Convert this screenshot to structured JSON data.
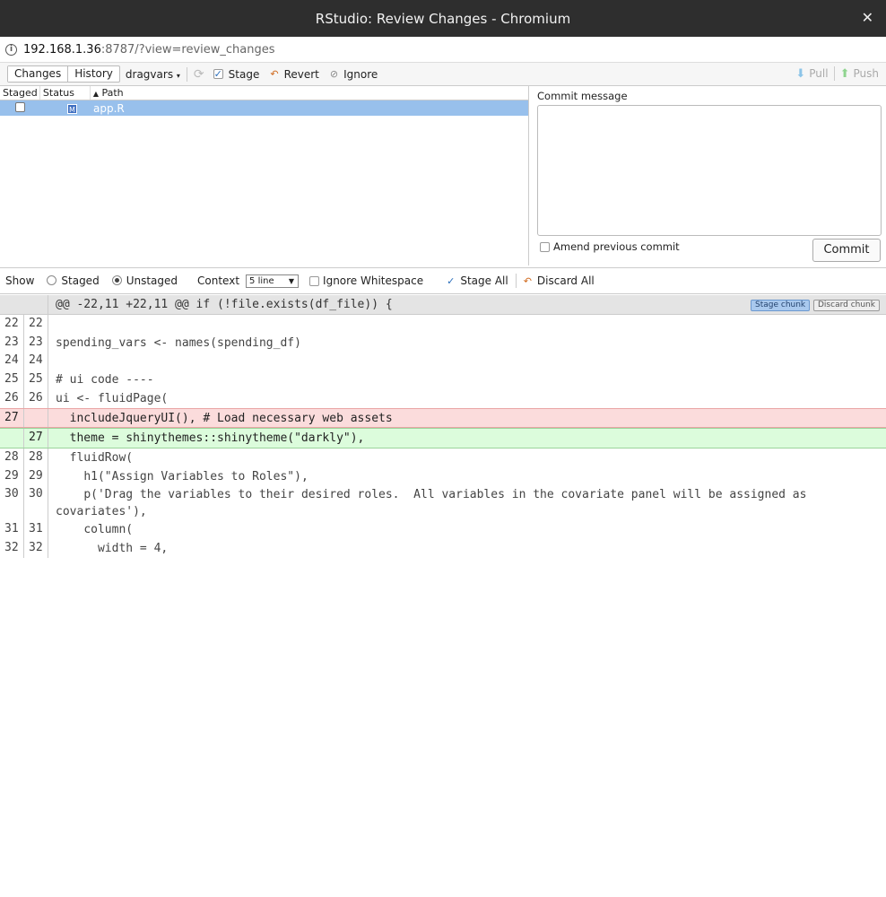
{
  "window": {
    "title": "RStudio: Review Changes - Chromium",
    "close_icon": "close-icon"
  },
  "url": {
    "host": "192.168.1.36",
    "path": ":8787/?view=review_changes"
  },
  "toolbar": {
    "tabs": [
      "Changes",
      "History"
    ],
    "branch": "dragvars",
    "stage_label": "Stage",
    "revert_label": "Revert",
    "ignore_label": "Ignore",
    "pull_label": "Pull",
    "push_label": "Push"
  },
  "files": {
    "columns": [
      "Staged",
      "Status",
      "Path"
    ],
    "rows": [
      {
        "status": "M",
        "path": "app.R",
        "staged": false
      }
    ]
  },
  "commit": {
    "label": "Commit message",
    "message": "",
    "amend_label": "Amend previous commit",
    "button": "Commit"
  },
  "diffbar": {
    "show_label": "Show",
    "staged_label": "Staged",
    "unstaged_label": "Unstaged",
    "context_label": "Context",
    "context_value": "5 line",
    "ignore_ws_label": "Ignore Whitespace",
    "stage_all_label": "Stage All",
    "discard_all_label": "Discard All"
  },
  "diff": {
    "hunk_header": "@@ -22,11 +22,11 @@ if (!file.exists(df_file)) {",
    "stage_chunk": "Stage chunk",
    "discard_chunk": "Discard chunk",
    "lines": [
      {
        "old": "22",
        "new": "22",
        "type": "ctx",
        "code": ""
      },
      {
        "old": "23",
        "new": "23",
        "type": "ctx",
        "code": "spending_vars <- names(spending_df)"
      },
      {
        "old": "24",
        "new": "24",
        "type": "ctx",
        "code": ""
      },
      {
        "old": "25",
        "new": "25",
        "type": "ctx",
        "code": "# ui code ----"
      },
      {
        "old": "26",
        "new": "26",
        "type": "ctx",
        "code": "ui <- fluidPage("
      },
      {
        "old": "27",
        "new": "",
        "type": "del",
        "code": "  includeJqueryUI(), # Load necessary web assets"
      },
      {
        "old": "",
        "new": "27",
        "type": "add",
        "code": "  theme = shinythemes::shinytheme(\"darkly\"),"
      },
      {
        "old": "28",
        "new": "28",
        "type": "ctx",
        "code": "  fluidRow("
      },
      {
        "old": "29",
        "new": "29",
        "type": "ctx",
        "code": "    h1(\"Assign Variables to Roles\"),"
      },
      {
        "old": "30",
        "new": "30",
        "type": "ctx",
        "code": "    p('Drag the variables to their desired roles.  All variables in the covariate panel will be assigned as covariates'),"
      },
      {
        "old": "31",
        "new": "31",
        "type": "ctx",
        "code": "    column("
      },
      {
        "old": "32",
        "new": "32",
        "type": "ctx",
        "code": "      width = 4,"
      }
    ]
  }
}
